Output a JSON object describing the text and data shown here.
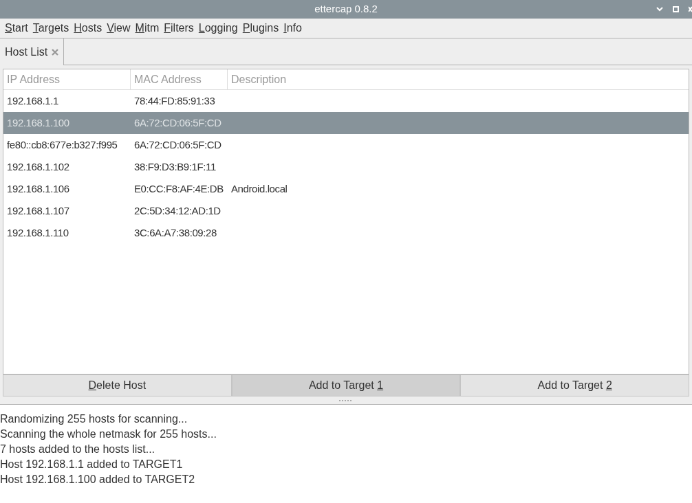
{
  "window": {
    "title": "ettercap 0.8.2"
  },
  "menu": [
    {
      "label": "Start",
      "mnemonic_last": false
    },
    {
      "label": "Targets",
      "mnemonic_last": false
    },
    {
      "label": "Hosts",
      "mnemonic_last": false
    },
    {
      "label": "View",
      "mnemonic_last": false
    },
    {
      "label": "Mitm",
      "mnemonic_last": false
    },
    {
      "label": "Filters",
      "mnemonic_last": false
    },
    {
      "label": "Logging",
      "mnemonic_last": false
    },
    {
      "label": "Plugins",
      "mnemonic_last": false
    },
    {
      "label": "Info",
      "mnemonic_last": false
    }
  ],
  "tabs": [
    {
      "label": "Host List",
      "selected": true
    }
  ],
  "table": {
    "columns": [
      "IP Address",
      "MAC Address",
      "Description"
    ],
    "rows": [
      {
        "cells": [
          "192.168.1.1",
          "78:44:FD:85:91:33",
          ""
        ],
        "selected": false
      },
      {
        "cells": [
          "192.168.1.100",
          "6A:72:CD:06:5F:CD",
          ""
        ],
        "selected": true
      },
      {
        "cells": [
          "fe80::cb8:677e:b327:f995",
          "6A:72:CD:06:5F:CD",
          ""
        ],
        "selected": false
      },
      {
        "cells": [
          "192.168.1.102",
          "38:F9:D3:B9:1F:11",
          ""
        ],
        "selected": false
      },
      {
        "cells": [
          "192.168.1.106",
          "E0:CC:F8:AF:4E:DB",
          "Android.local"
        ],
        "selected": false
      },
      {
        "cells": [
          "192.168.1.107",
          "2C:5D:34:12:AD:1D",
          ""
        ],
        "selected": false
      },
      {
        "cells": [
          "192.168.1.110",
          "3C:6A:A7:38:09:28",
          ""
        ],
        "selected": false
      }
    ]
  },
  "buttons": [
    {
      "label": "Delete Host",
      "mnemonic_last": false,
      "hovered": false
    },
    {
      "label": "Add to Target 1",
      "mnemonic_last": true,
      "hovered": true
    },
    {
      "label": "Add to Target 2",
      "mnemonic_last": true,
      "hovered": false
    }
  ],
  "log": [
    "Randomizing 255 hosts for scanning...",
    "Scanning the whole netmask for 255 hosts...",
    "7 hosts added to the hosts list...",
    "Host 192.168.1.1 added to TARGET1",
    "Host 192.168.1.100 added to TARGET2"
  ]
}
